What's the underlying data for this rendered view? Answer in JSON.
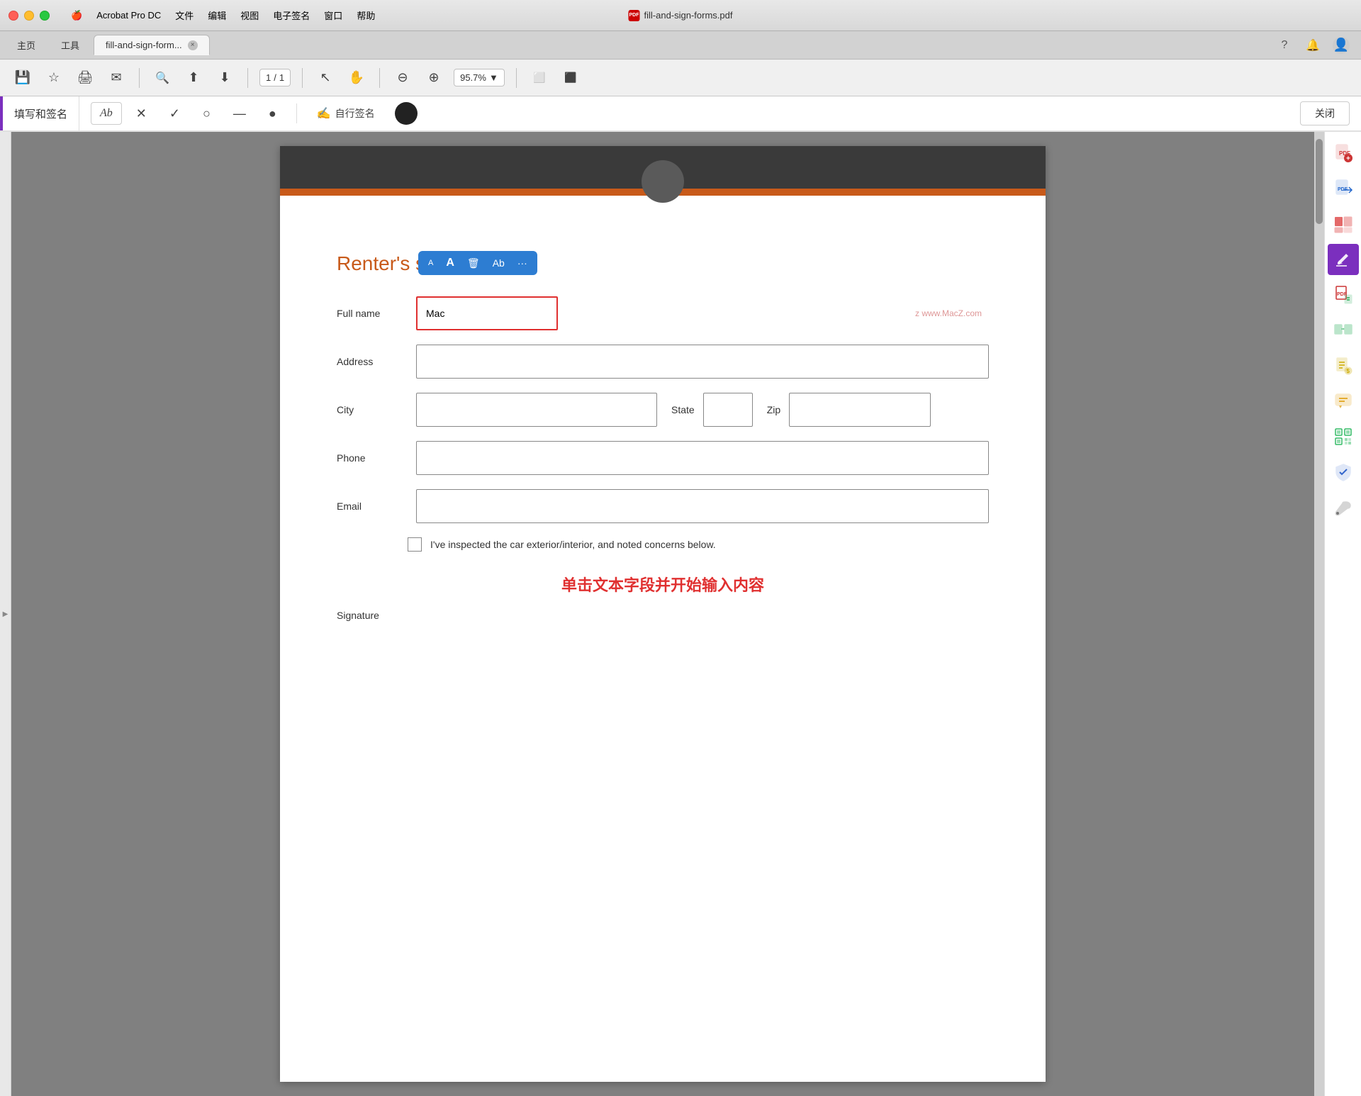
{
  "titleBar": {
    "appName": "Acrobat Pro DC",
    "menuItems": [
      "文件",
      "编辑",
      "视图",
      "电子签名",
      "窗口",
      "帮助"
    ],
    "fileTitle": "fill-and-sign-forms.pdf",
    "appleMenu": "🍎"
  },
  "tabBar": {
    "homeTab": "主页",
    "toolsTab": "工具",
    "activeTab": "fill-and-sign-form...",
    "closeTabLabel": "×"
  },
  "toolbar": {
    "pageNum": "1",
    "totalPages": "1",
    "pageSeparator": "/",
    "zoomLevel": "95.7%",
    "zoomDropdown": "▼"
  },
  "fillSignBar": {
    "label": "填写和签名",
    "tools": [
      "Ab",
      "×",
      "✓",
      "○",
      "—",
      "●"
    ],
    "selfSign": "自行签名",
    "closeBtn": "关闭"
  },
  "pdfContent": {
    "sectionTitle": "Renter's section",
    "fields": {
      "fullNameLabel": "Full name",
      "fullNameValue": "Mac",
      "addressLabel": "Address",
      "cityLabel": "City",
      "stateLabel": "State",
      "zipLabel": "Zip",
      "phoneLabel": "Phone",
      "emailLabel": "Email",
      "signatureLabel": "Signature"
    },
    "checkbox": {
      "label": "I've inspected the car exterior/interior, and noted concerns below."
    },
    "watermark": "z www.MacZ.com",
    "instructionText": "单击文本字段并开始输入内容"
  },
  "textToolbar": {
    "smallA": "A",
    "largeA": "A",
    "deleteIcon": "🗑",
    "abIcon": "Ab",
    "moreIcon": "···"
  },
  "rightSidebar": {
    "icons": [
      {
        "name": "pdf-create",
        "symbol": "📄",
        "color": "red"
      },
      {
        "name": "export-pdf",
        "symbol": "📤",
        "color": "blue"
      },
      {
        "name": "organize",
        "symbol": "📋",
        "color": "red2"
      },
      {
        "name": "fill-sign",
        "symbol": "✏️",
        "color": "purple"
      },
      {
        "name": "pdf-export2",
        "symbol": "📑",
        "color": "red"
      },
      {
        "name": "combine",
        "symbol": "📊",
        "color": "green"
      },
      {
        "name": "export-doc",
        "symbol": "📃",
        "color": "yellow"
      },
      {
        "name": "comment",
        "symbol": "💬",
        "color": "msg"
      },
      {
        "name": "barcode",
        "symbol": "📱",
        "color": "green2"
      },
      {
        "name": "shield",
        "symbol": "🛡",
        "color": "blue"
      },
      {
        "name": "tools",
        "symbol": "🔧",
        "color": "gray"
      }
    ]
  }
}
